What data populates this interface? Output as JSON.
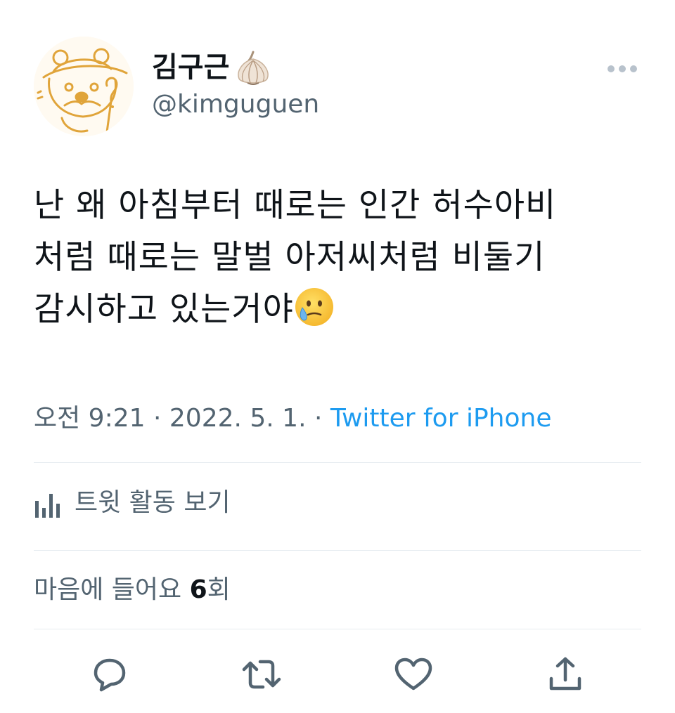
{
  "author": {
    "display_name": "김구근",
    "name_emoji": "garlic-icon",
    "handle": "@kimguguen"
  },
  "tweet": {
    "lines": [
      "난 왜 아침부터 때로는 인간 허수아비",
      "처럼 때로는 말벌 아저씨처럼 비둘기",
      "감시하고 있는거야"
    ],
    "trailing_emoji": "face-holding-back-tears-icon"
  },
  "meta": {
    "time": "오전 9:21",
    "separator": "·",
    "date": "2022. 5. 1.",
    "source": "Twitter for iPhone"
  },
  "activity": {
    "label": "트윗 활동 보기"
  },
  "likes": {
    "prefix": "마음에 들어요 ",
    "count": "6",
    "suffix": "회"
  },
  "actions": [
    "reply-icon",
    "retweet-icon",
    "like-icon",
    "share-icon"
  ],
  "colors": {
    "text": "#0f1419",
    "secondary": "#536471",
    "link": "#1d9bf0",
    "divider": "#e6ecf0",
    "avatar_line": "#e0a43a"
  }
}
